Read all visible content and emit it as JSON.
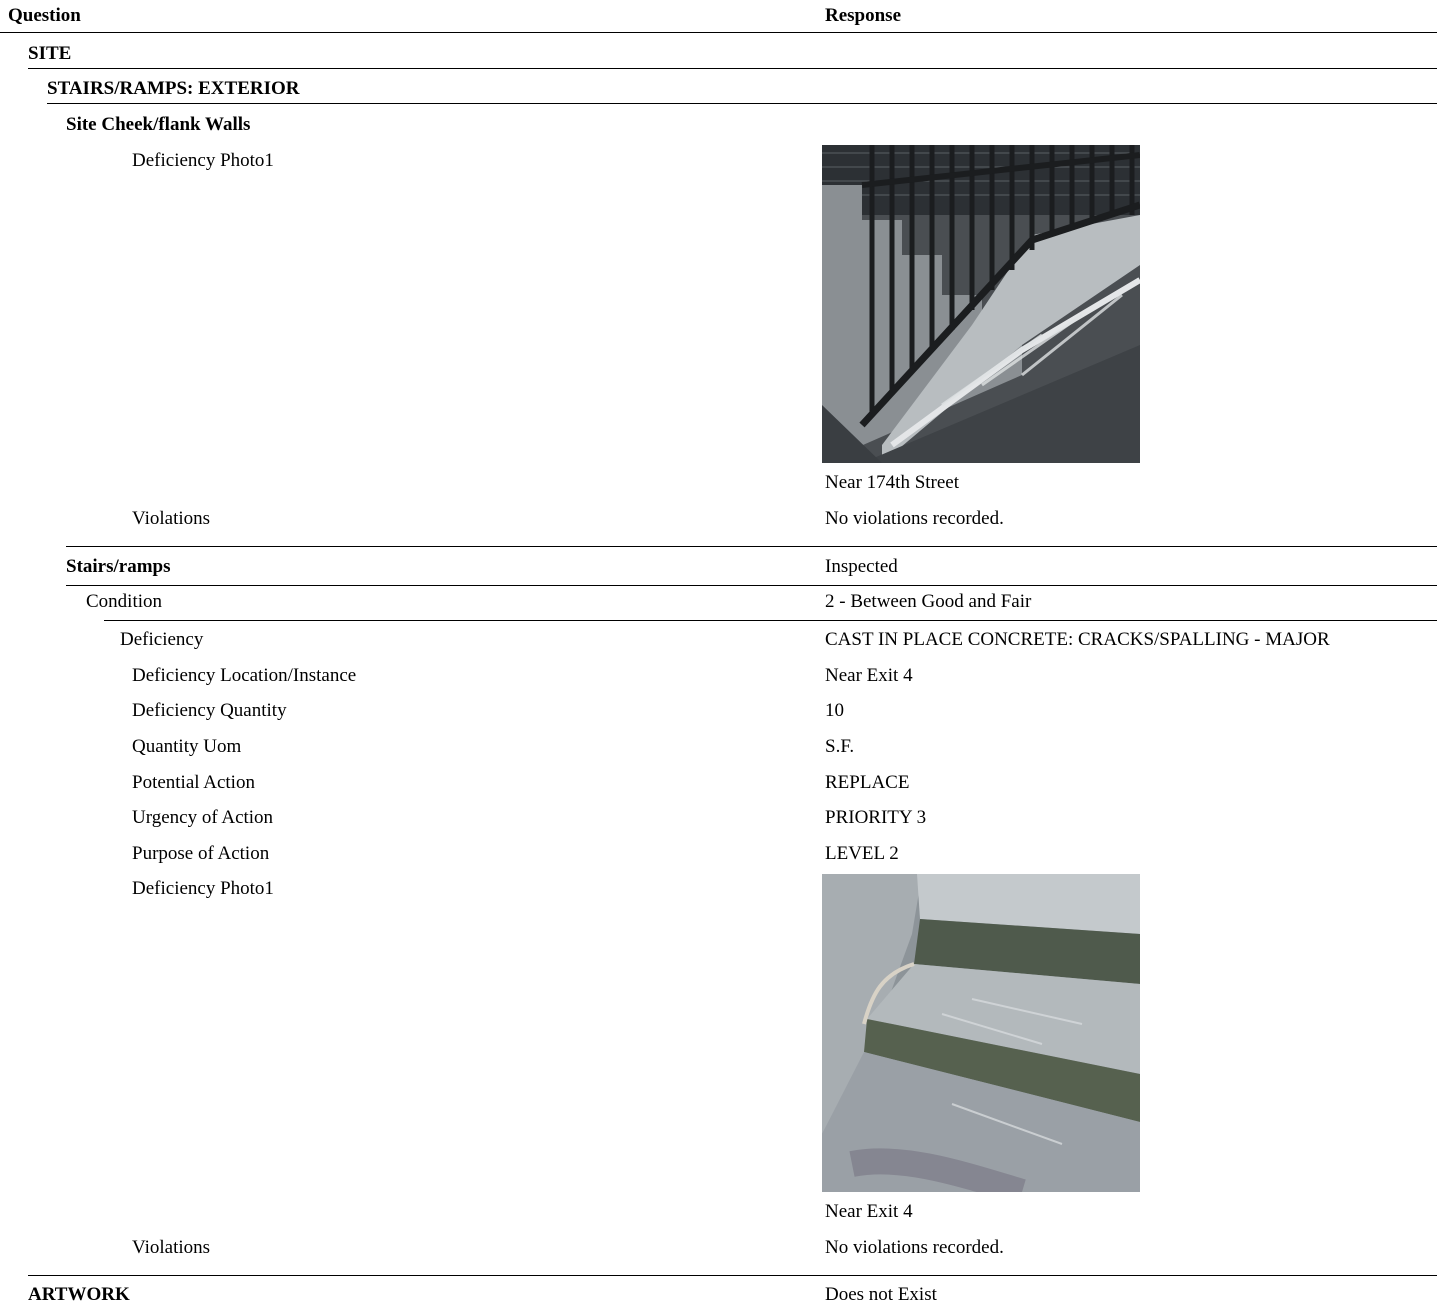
{
  "header": {
    "question": "Question",
    "response": "Response"
  },
  "site": {
    "title": "SITE",
    "stairs_exterior": {
      "title": "STAIRS/RAMPS: EXTERIOR",
      "cheek_walls": {
        "title": "Site Cheek/flank Walls",
        "photo_label": "Deficiency Photo1",
        "photo_caption": "Near 174th Street",
        "violations_label": "Violations",
        "violations_value": "No violations recorded."
      },
      "stairs_ramps": {
        "title": "Stairs/ramps",
        "status": "Inspected",
        "condition_label": "Condition",
        "condition_value": "2 - Between Good and Fair",
        "deficiency_label": "Deficiency",
        "deficiency_value": "CAST IN PLACE CONCRETE: CRACKS/SPALLING - MAJOR",
        "fields": [
          {
            "label": "Deficiency Location/Instance",
            "value": "Near Exit 4"
          },
          {
            "label": "Deficiency Quantity",
            "value": "10"
          },
          {
            "label": "Quantity Uom",
            "value": "S.F."
          },
          {
            "label": "Potential Action",
            "value": "REPLACE"
          },
          {
            "label": "Urgency of Action",
            "value": "PRIORITY 3"
          },
          {
            "label": "Purpose of Action",
            "value": "LEVEL 2"
          }
        ],
        "photo_label": "Deficiency Photo1",
        "photo_caption": "Near Exit 4",
        "violations_label": "Violations",
        "violations_value": "No violations recorded."
      }
    }
  },
  "artwork": {
    "title": "ARTWORK",
    "value": "Does not Exist"
  }
}
